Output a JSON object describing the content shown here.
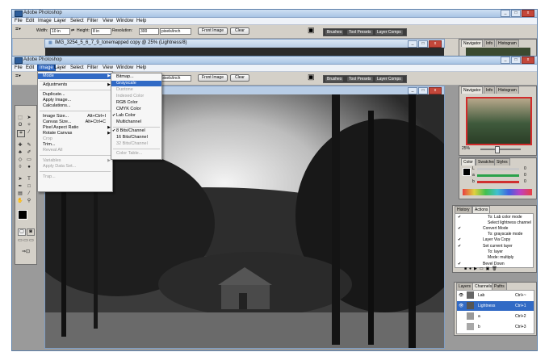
{
  "back_window": {
    "app_title": "Adobe Photoshop",
    "menu": [
      "File",
      "Edit",
      "Image",
      "Layer",
      "Select",
      "Filter",
      "View",
      "Window",
      "Help"
    ],
    "options": {
      "width_label": "Width:",
      "width_value": "10 in",
      "height_label": "Height:",
      "height_value": "8 in",
      "resolution_label": "Resolution:",
      "resolution_value": "300",
      "resolution_unit": "pixels/inch",
      "front_image": "Front Image",
      "clear": "Clear"
    },
    "wells": [
      "Brushes",
      "Tool Presets",
      "Layer Comps"
    ],
    "doc_title": "IMG_3254_5_6_7_9_tonemapped copy @ 25% (Lightness/8)",
    "navigator_tabs": [
      "Navigator",
      "Info",
      "Histogram"
    ]
  },
  "front_window": {
    "app_title": "Adobe Photoshop",
    "menu": [
      "File",
      "Edit",
      "Image",
      "Layer",
      "Select",
      "Filter",
      "View",
      "Window",
      "Help"
    ],
    "options": {
      "resolution_unit": "pixels/inch",
      "front_image": "Front Image",
      "clear": "Clear"
    },
    "wells": [
      "Brushes",
      "Tool Presets",
      "Layer Comps"
    ]
  },
  "image_menu": {
    "items": [
      "Mode",
      "Adjustments",
      "Duplicate...",
      "Apply Image...",
      "Calculations...",
      "Image Size...",
      "Canvas Size...",
      "Pixel Aspect Ratio",
      "Rotate Canvas",
      "Crop",
      "Trim...",
      "Reveal All",
      "Variables",
      "Apply Data Set...",
      "Trap..."
    ],
    "shortcuts": {
      "image_size": "Alt+Ctrl+I",
      "canvas_size": "Alt+Ctrl+C"
    }
  },
  "mode_menu": {
    "items": [
      "Bitmap...",
      "Grayscale",
      "Duotone",
      "Indexed Color",
      "RGB Color",
      "CMYK Color",
      "Lab Color",
      "Multichannel",
      "8 Bits/Channel",
      "16 Bits/Channel",
      "32 Bits/Channel",
      "Color Table..."
    ],
    "check": "✔"
  },
  "navigator": {
    "tabs": [
      "Navigator",
      "Info",
      "Histogram"
    ],
    "zoom": "25%"
  },
  "color_panel": {
    "tabs": [
      "Color",
      "Swatches",
      "Styles"
    ],
    "channels": [
      {
        "label": "L",
        "value": "0"
      },
      {
        "label": "a",
        "value": "0"
      },
      {
        "label": "b",
        "value": "0"
      }
    ],
    "colors": {
      "l": "#c8c8c8",
      "a": "#2aa24a",
      "b": "#d03030"
    }
  },
  "actions_panel": {
    "tabs": [
      "History",
      "Actions"
    ],
    "items": [
      "To: Lab color mode",
      "Select lightness channel",
      "Convert Mode",
      "To: grayscale mode",
      "Layer Via Copy",
      "Set current layer",
      "To: layer",
      "Mode: multiply",
      "Bevel Down"
    ]
  },
  "channels_panel": {
    "tabs": [
      "Layers",
      "Channels",
      "Paths"
    ],
    "rows": [
      {
        "name": "Lab",
        "shortcut": "Ctrl+~"
      },
      {
        "name": "Lightness",
        "shortcut": "Ctrl+1"
      },
      {
        "name": "a",
        "shortcut": "Ctrl+2"
      },
      {
        "name": "b",
        "shortcut": "Ctrl+3"
      }
    ]
  }
}
